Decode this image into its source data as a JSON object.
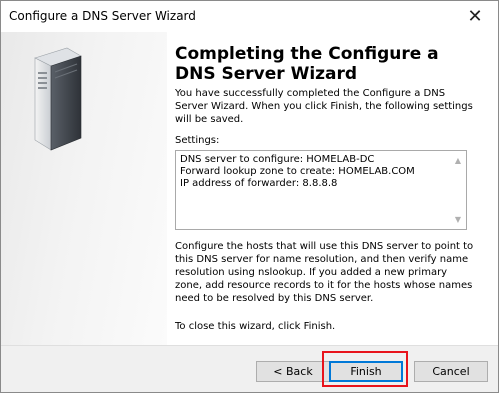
{
  "window": {
    "title": "Configure a DNS Server Wizard",
    "close_glyph": "✕"
  },
  "main": {
    "heading": "Completing the Configure a DNS Server Wizard",
    "intro": "You have successfully completed the Configure a DNS Server Wizard. When you click Finish, the following settings will be saved.",
    "settings_label": "Settings:",
    "settings": [
      "DNS server to configure: HOMELAB-DC",
      "Forward lookup zone to create: HOMELAB.COM",
      "IP address of forwarder: 8.8.8.8"
    ],
    "hosts_text": "Configure the hosts that will use this DNS server to point to this DNS server for name resolution, and then verify name resolution using nslookup. If you added a new primary zone, add resource records to it for the hosts whose names need to be resolved by this DNS server.",
    "close_text": "To close this wizard, click Finish."
  },
  "buttons": {
    "back": "< Back",
    "finish": "Finish",
    "cancel": "Cancel"
  },
  "icons": {
    "server": "server-tower-icon",
    "scroll_up": "▲",
    "scroll_down": "▼"
  },
  "colors": {
    "highlight": "#e8141c",
    "focus": "#0078d7"
  }
}
